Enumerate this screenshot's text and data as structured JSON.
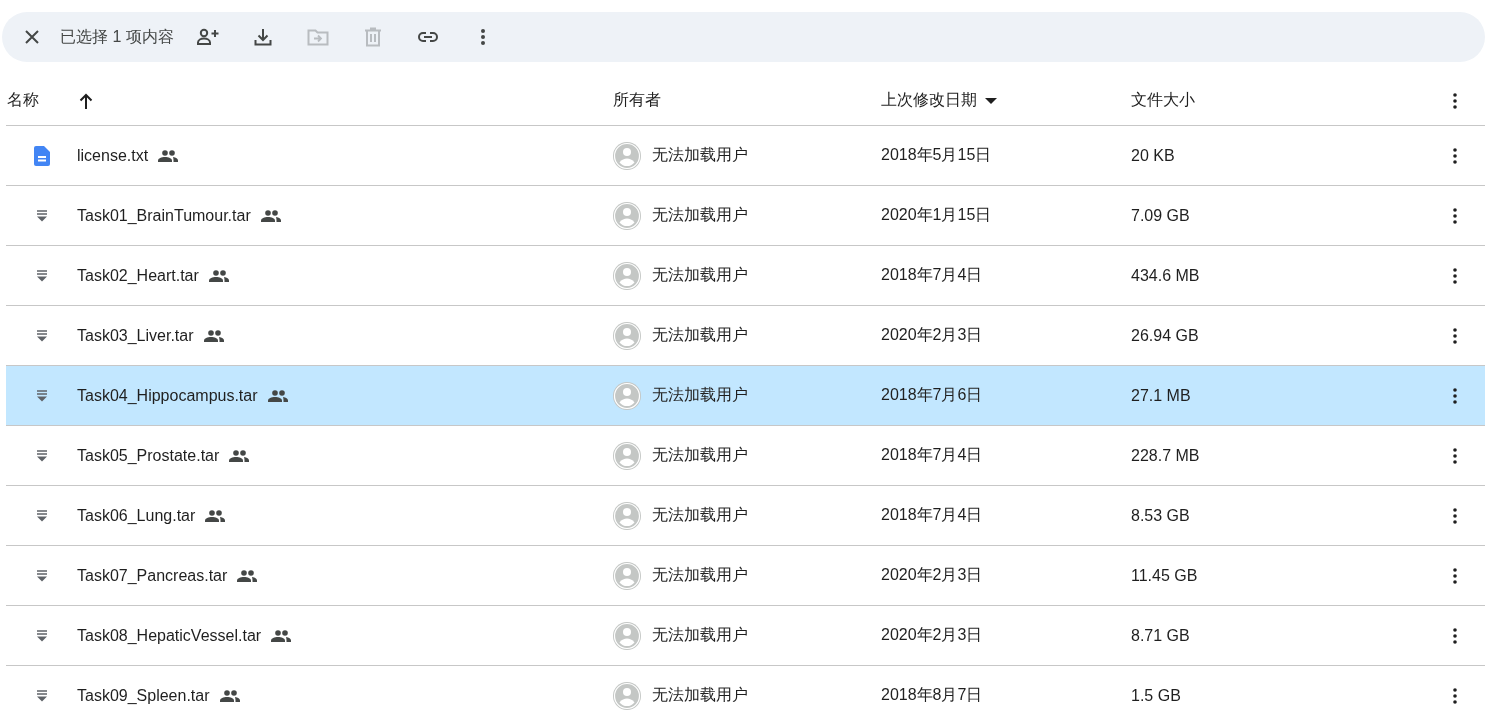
{
  "selection_bar": {
    "label": "已选择 1 项内容",
    "actions": [
      {
        "kind": "share",
        "disabled": false
      },
      {
        "kind": "download",
        "disabled": false
      },
      {
        "kind": "move",
        "disabled": true
      },
      {
        "kind": "trash",
        "disabled": true
      },
      {
        "kind": "link",
        "disabled": false
      },
      {
        "kind": "more",
        "disabled": false
      }
    ]
  },
  "table": {
    "columns": [
      {
        "label": "名称",
        "sorted": true,
        "ascending": true
      },
      {
        "label": "所有者",
        "sorted": false
      },
      {
        "label": "上次修改日期",
        "sorted": true,
        "ascending": false
      },
      {
        "label": "文件大小",
        "sorted": false
      }
    ],
    "rows": [
      {
        "kind": "doc",
        "name": "license.txt",
        "owner": "无法加载用户",
        "modified": "2018年5月15日",
        "size": "20 KB",
        "selected": false
      },
      {
        "kind": "archive",
        "name": "Task01_BrainTumour.tar",
        "owner": "无法加载用户",
        "modified": "2020年1月15日",
        "size": "7.09 GB",
        "selected": false
      },
      {
        "kind": "archive",
        "name": "Task02_Heart.tar",
        "owner": "无法加载用户",
        "modified": "2018年7月4日",
        "size": "434.6 MB",
        "selected": false
      },
      {
        "kind": "archive",
        "name": "Task03_Liver.tar",
        "owner": "无法加载用户",
        "modified": "2020年2月3日",
        "size": "26.94 GB",
        "selected": false
      },
      {
        "kind": "archive",
        "name": "Task04_Hippocampus.tar",
        "owner": "无法加载用户",
        "modified": "2018年7月6日",
        "size": "27.1 MB",
        "selected": true
      },
      {
        "kind": "archive",
        "name": "Task05_Prostate.tar",
        "owner": "无法加载用户",
        "modified": "2018年7月4日",
        "size": "228.7 MB",
        "selected": false
      },
      {
        "kind": "archive",
        "name": "Task06_Lung.tar",
        "owner": "无法加载用户",
        "modified": "2018年7月4日",
        "size": "8.53 GB",
        "selected": false
      },
      {
        "kind": "archive",
        "name": "Task07_Pancreas.tar",
        "owner": "无法加载用户",
        "modified": "2020年2月3日",
        "size": "11.45 GB",
        "selected": false
      },
      {
        "kind": "archive",
        "name": "Task08_HepaticVessel.tar",
        "owner": "无法加载用户",
        "modified": "2020年2月3日",
        "size": "8.71 GB",
        "selected": false
      },
      {
        "kind": "archive",
        "name": "Task09_Spleen.tar",
        "owner": "无法加载用户",
        "modified": "2018年8月7日",
        "size": "1.5 GB",
        "selected": false
      }
    ]
  }
}
